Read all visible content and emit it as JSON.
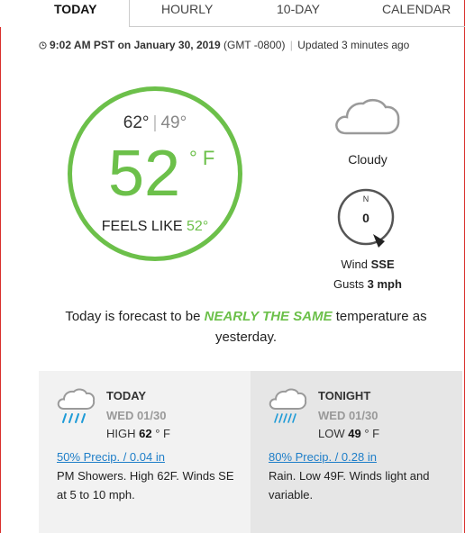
{
  "tabs": [
    {
      "label": "TODAY",
      "active": true
    },
    {
      "label": "HOURLY",
      "active": false
    },
    {
      "label": "10-DAY",
      "active": false
    },
    {
      "label": "CALENDAR",
      "active": false
    }
  ],
  "status": {
    "clock_icon": "clock-icon",
    "time": "9:02 AM PST on January 30, 2019",
    "gmt": "(GMT -0800)",
    "updated": "Updated 3 minutes ago"
  },
  "current": {
    "high": "62°",
    "low": "49°",
    "temp": "52",
    "unit": "° F",
    "feels_like_label": "FEELS LIKE",
    "feels_like_value": "52°",
    "accent_color": "#6cc04a"
  },
  "conditions": {
    "icon": "cloud-icon",
    "label": "Cloudy",
    "wind_dial_north": "N",
    "wind_speed": "0",
    "wind_label": "Wind",
    "wind_dir": "SSE",
    "gusts_label": "Gusts",
    "gusts_value": "3 mph"
  },
  "forecast": {
    "prefix": "Today is forecast to be",
    "emphasis": "NEARLY THE SAME",
    "suffix": "temperature as yesterday."
  },
  "cards": [
    {
      "icon": "rain-cloud-icon",
      "title": "TODAY",
      "date": "WED 01/30",
      "hl_label": "HIGH",
      "hl_value": "62",
      "hl_unit": "° F",
      "precip": "50% Precip. / 0.04 in",
      "desc": "PM Showers. High 62F. Winds SE at 5 to 10 mph."
    },
    {
      "icon": "rain-cloud-icon",
      "title": "TONIGHT",
      "date": "WED 01/30",
      "hl_label": "LOW",
      "hl_value": "49",
      "hl_unit": "° F",
      "precip": "80% Precip. / 0.28 in",
      "desc": "Rain. Low 49F. Winds light and variable."
    }
  ]
}
